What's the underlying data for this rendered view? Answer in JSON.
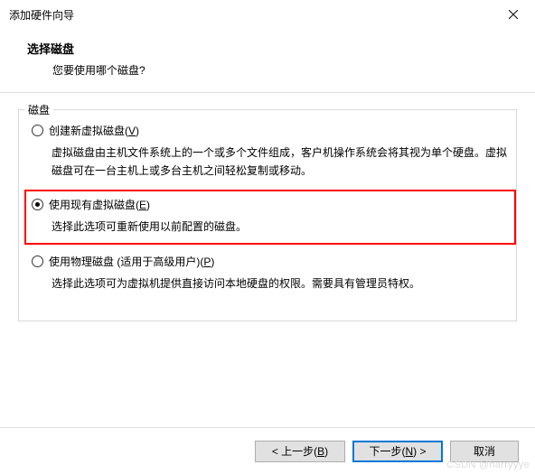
{
  "window": {
    "title": "添加硬件向导",
    "close_icon": "×"
  },
  "header": {
    "heading": "选择磁盘",
    "subheading": "您要使用哪个磁盘?"
  },
  "group": {
    "label": "磁盘"
  },
  "options": [
    {
      "label_pre": "创建新虚拟磁盘(",
      "mnemonic": "V",
      "label_post": ")",
      "desc": "虚拟磁盘由主机文件系统上的一个或多个文件组成，客户机操作系统会将其视为单个硬盘。虚拟磁盘可在一台主机上或多台主机之间轻松复制或移动。",
      "selected": false,
      "highlight": false
    },
    {
      "label_pre": "使用现有虚拟磁盘(",
      "mnemonic": "E",
      "label_post": ")",
      "desc": "选择此选项可重新使用以前配置的磁盘。",
      "selected": true,
      "highlight": true
    },
    {
      "label_pre": "使用物理磁盘 (适用于高级用户)(",
      "mnemonic": "P",
      "label_post": ")",
      "desc": "选择此选项可为虚拟机提供直接访问本地硬盘的权限。需要具有管理员特权。",
      "selected": false,
      "highlight": false
    }
  ],
  "buttons": {
    "back_pre": "< 上一步(",
    "back_mn": "B",
    "back_post": ")",
    "next_pre": "下一步(",
    "next_mn": "N",
    "next_post": ") >",
    "cancel": "取消"
  },
  "watermark": "CSDN @harryyye"
}
